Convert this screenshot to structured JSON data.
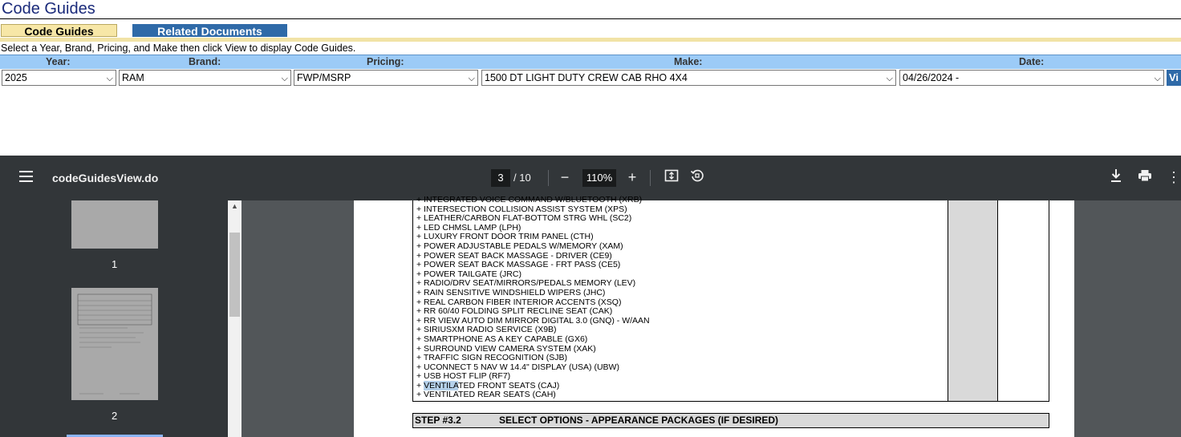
{
  "page_title": "Code Guides",
  "tabs": {
    "code_guides": "Code Guides",
    "related_documents": "Related Documents"
  },
  "instructions": "Select a Year, Brand, Pricing, and Make then click View to display Code Guides.",
  "filters": {
    "year_label": "Year:",
    "brand_label": "Brand:",
    "pricing_label": "Pricing:",
    "make_label": "Make:",
    "date_label": "Date:",
    "year_value": "2025",
    "brand_value": "RAM",
    "pricing_value": "FWP/MSRP",
    "make_value": "1500 DT LIGHT DUTY CREW CAB RHO 4X4",
    "date_value": "04/26/2024 -",
    "view_button": "Vi"
  },
  "viewer": {
    "filename": "codeGuidesView.do",
    "current_page": "3",
    "total_pages": "/ 10",
    "zoom": "110%",
    "thumbnails": [
      "1",
      "2"
    ]
  },
  "document": {
    "options": [
      "+ INTEGRATED VOICE COMMAND W/BLUETOOTH (XRB)",
      "+ INTERSECTION COLLISION ASSIST SYSTEM (XPS)",
      "+ LEATHER/CARBON FLAT-BOTTOM STRG WHL (SC2)",
      "+ LED CHMSL LAMP (LPH)",
      "+ LUXURY FRONT DOOR TRIM PANEL (CTH)",
      "+ POWER ADJUSTABLE PEDALS W/MEMORY (XAM)",
      "+ POWER SEAT BACK MASSAGE - DRIVER (CE9)",
      "+ POWER SEAT BACK MASSAGE - FRT PASS (CE5)",
      "+ POWER TAILGATE (JRC)",
      "+ RADIO/DRV SEAT/MIRRORS/PEDALS MEMORY (LEV)",
      "+ RAIN SENSITIVE WINDSHIELD WIPERS (JHC)",
      "+ REAL CARBON FIBER INTERIOR ACCENTS (XSQ)",
      "+ RR 60/40 FOLDING SPLIT RECLINE SEAT (CAK)",
      "+ RR VIEW AUTO DIM MIRROR DIGITAL 3.0 (GNQ) - W/AAN",
      "+ SIRIUSXM RADIO SERVICE (X9B)",
      "+ SMARTPHONE AS A KEY CAPABLE (GX6)",
      "+ SURROUND VIEW CAMERA SYSTEM (XAK)",
      "+ TRAFFIC SIGN RECOGNITION (SJB)",
      "+ UCONNECT 5 NAV W 14.4\" DISPLAY (USA) (UBW)",
      "+ USB HOST FLIP (RF7)"
    ],
    "highlight_prefix": "+ ",
    "highlight_word": "VENTILA",
    "highlight_rest": "TED FRONT SEATS (CAJ)",
    "last_option": "+ VENTILATED REAR SEATS (CAH)",
    "step_number": "STEP #3.2",
    "step_text": "SELECT OPTIONS - APPEARANCE PACKAGES (IF DESIRED)"
  }
}
